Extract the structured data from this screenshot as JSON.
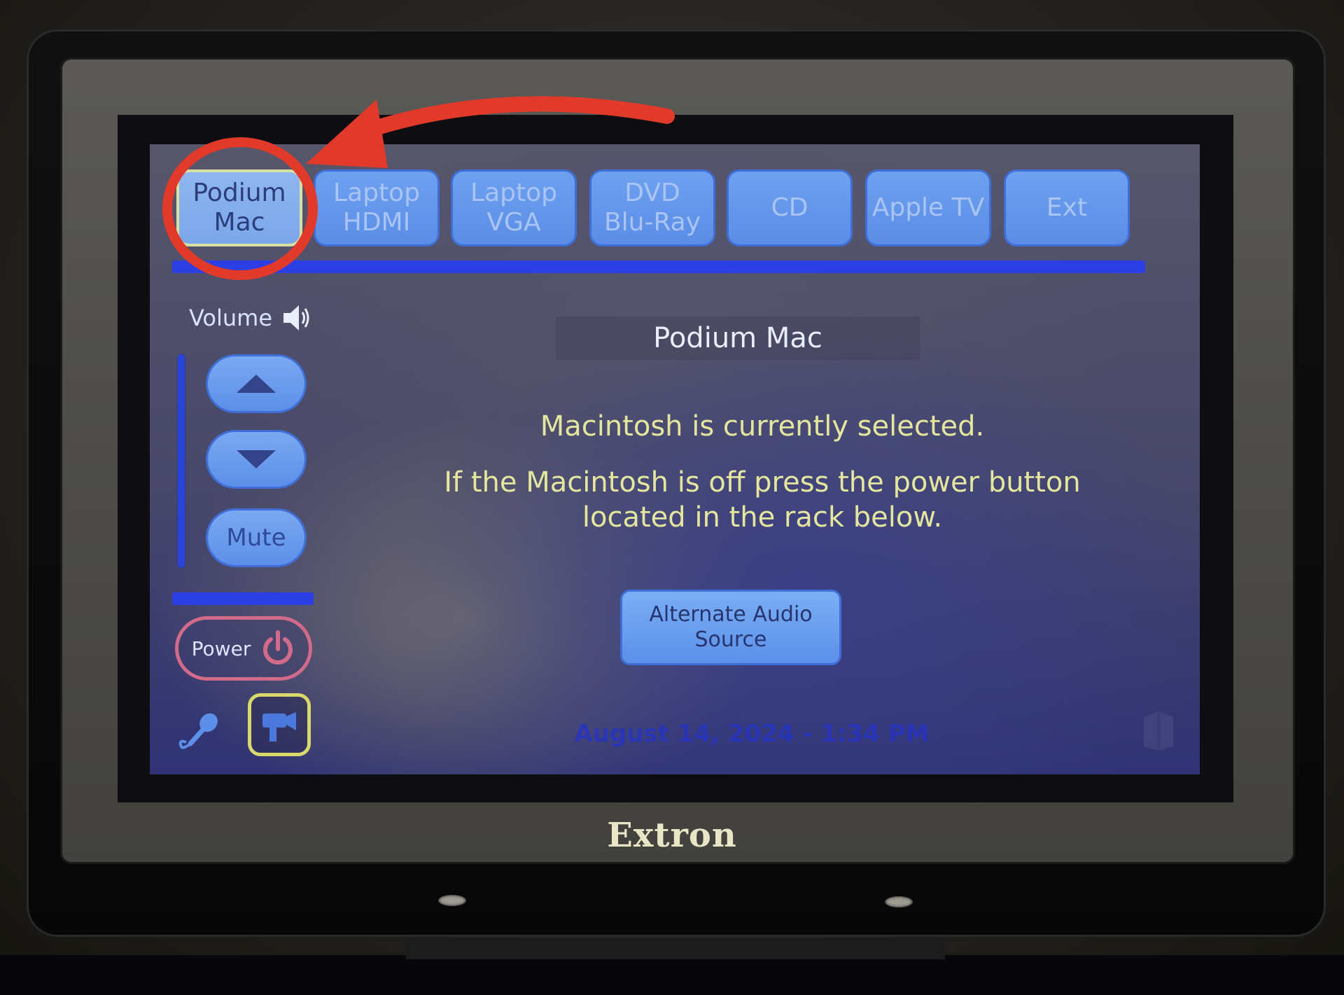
{
  "tabs": [
    {
      "label": "Podium\nMac",
      "selected": true
    },
    {
      "label": "Laptop\nHDMI",
      "selected": false
    },
    {
      "label": "Laptop\nVGA",
      "selected": false
    },
    {
      "label": "DVD\nBlu-Ray",
      "selected": false
    },
    {
      "label": "CD",
      "selected": false
    },
    {
      "label": "Apple TV",
      "selected": false
    },
    {
      "label": "Ext",
      "selected": false
    }
  ],
  "volume": {
    "label": "Volume",
    "mute_label": "Mute"
  },
  "power": {
    "label": "Power"
  },
  "main": {
    "title": "Podium Mac",
    "status": "Macintosh is currently selected.",
    "instructions": "If the Macintosh is off press the power button\nlocated in the rack below.",
    "alt_audio_button": "Alternate Audio\nSource",
    "datetime": "August 14, 2024  -  1:34 PM"
  },
  "brand": "Extron",
  "colors": {
    "accent_blue": "#2c3fe4",
    "button_blue": "#5c8fe8",
    "message_yellow": "#e4e69e",
    "power_pink": "#d26a8a",
    "annotation_red": "#e23a2a"
  }
}
